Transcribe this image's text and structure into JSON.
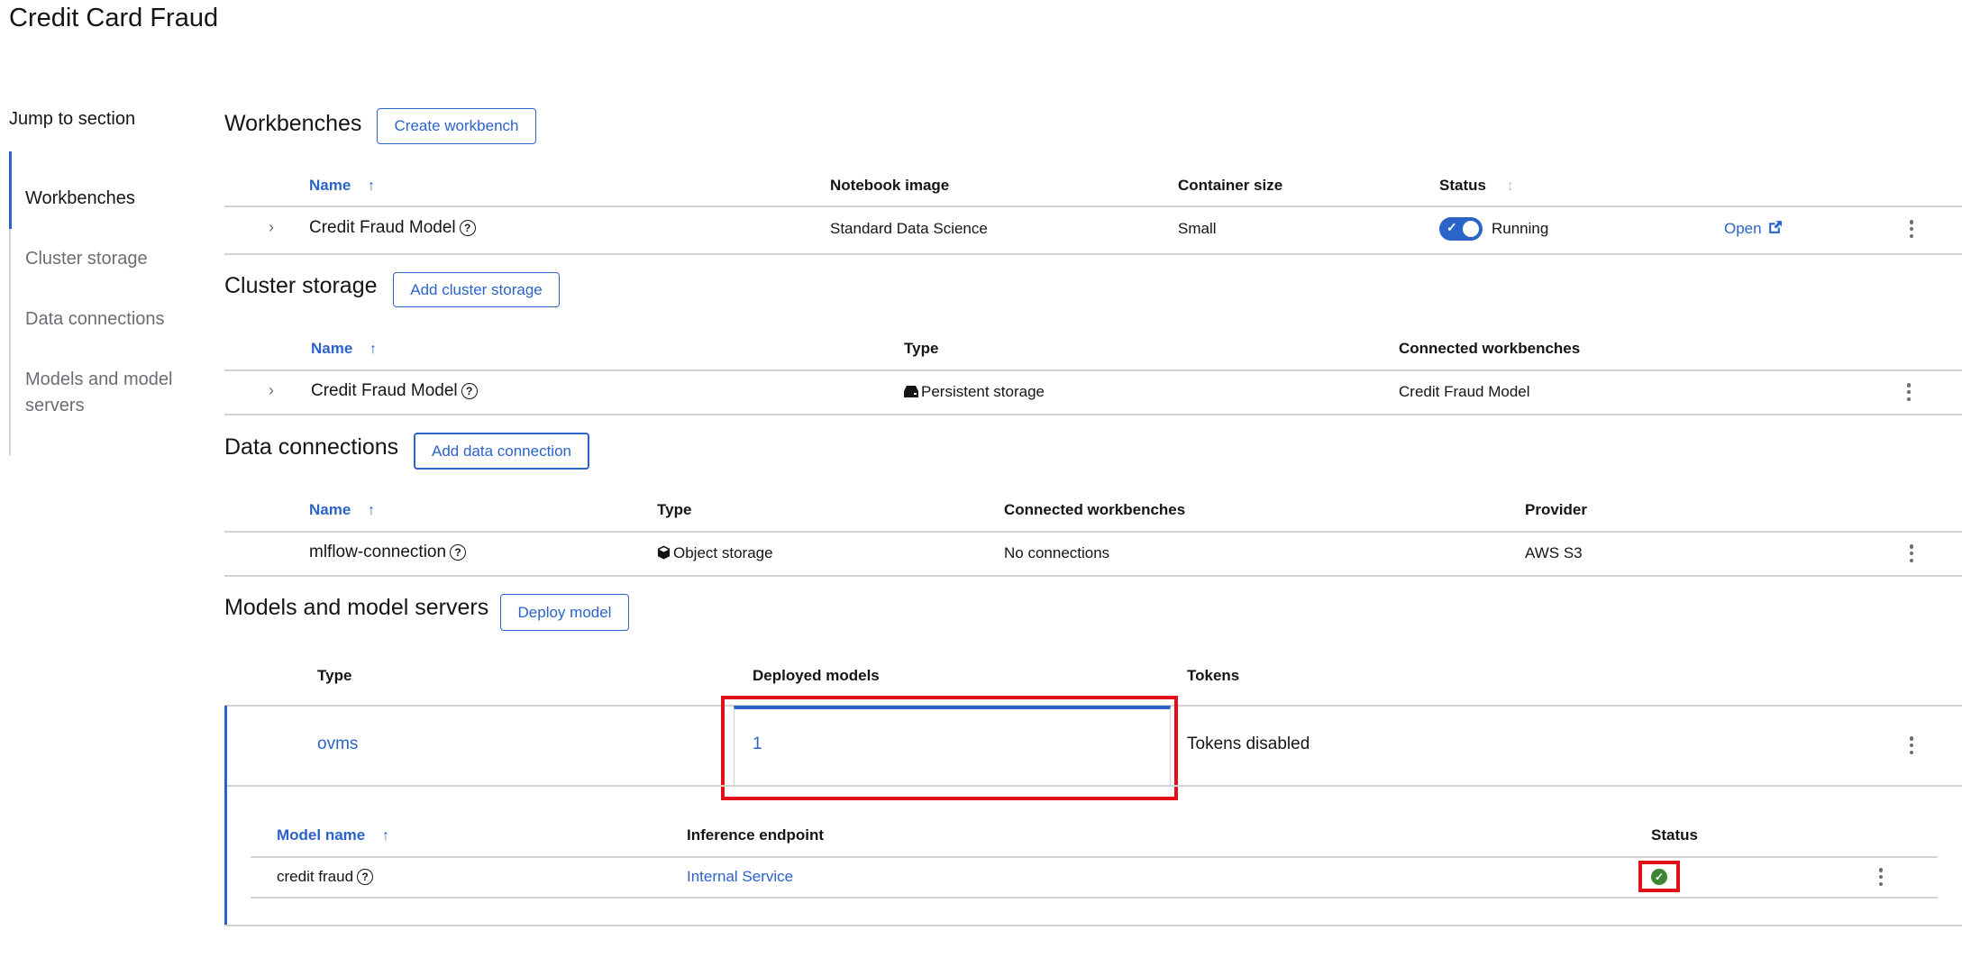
{
  "page": {
    "title": "Credit Card Fraud"
  },
  "jump_nav": {
    "label": "Jump to section",
    "items": [
      {
        "label": "Workbenches",
        "active": true
      },
      {
        "label": "Cluster storage",
        "active": false
      },
      {
        "label": "Data connections",
        "active": false
      },
      {
        "label": "Models and model",
        "label2": "servers",
        "active": false
      }
    ]
  },
  "workbenches": {
    "heading": "Workbenches",
    "button": "Create workbench",
    "columns": [
      "Name",
      "Notebook image",
      "Container size",
      "Status"
    ],
    "rows": [
      {
        "name": "Credit Fraud Model",
        "notebook_image": "Standard Data Science",
        "container_size": "Small",
        "status": "Running",
        "toggle_on": true,
        "open_label": "Open"
      }
    ]
  },
  "cluster_storage": {
    "heading": "Cluster storage",
    "button": "Add cluster storage",
    "columns": [
      "Name",
      "Type",
      "Connected workbenches"
    ],
    "rows": [
      {
        "name": "Credit Fraud Model",
        "type": "Persistent storage",
        "connected": "Credit Fraud Model"
      }
    ]
  },
  "data_connections": {
    "heading": "Data connections",
    "button": "Add data connection",
    "columns": [
      "Name",
      "Type",
      "Connected workbenches",
      "Provider"
    ],
    "rows": [
      {
        "name": "mlflow-connection",
        "type": "Object storage",
        "connected": "No connections",
        "provider": "AWS S3"
      }
    ]
  },
  "models": {
    "heading": "Models and model servers",
    "button": "Deploy model",
    "columns": [
      "Type",
      "Deployed models",
      "Tokens"
    ],
    "rows": [
      {
        "type": "ovms",
        "deployed_models": "1",
        "tokens": "Tokens disabled"
      }
    ],
    "nested": {
      "columns": [
        "Model name",
        "Inference endpoint",
        "Status"
      ],
      "rows": [
        {
          "name": "credit fraud",
          "endpoint": "Internal Service",
          "status": "success"
        }
      ]
    }
  },
  "colors": {
    "accent": "#2b63c9",
    "success": "#3e8635",
    "highlight": "#e3101c"
  }
}
